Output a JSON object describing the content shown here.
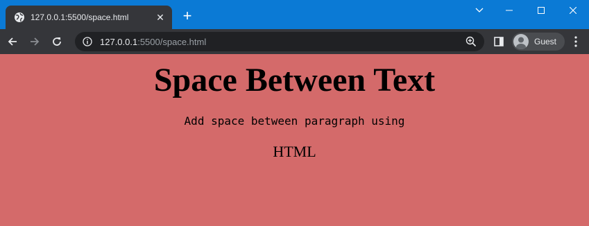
{
  "browser": {
    "tab_title": "127.0.0.1:5500/space.html",
    "tab_close": "✕",
    "new_tab": "+",
    "url_host": "127.0.0.1",
    "url_path": ":5500/space.html",
    "profile_name": "Guest",
    "titlebar_color": "#0b7ad5",
    "toolbar_color": "#35363a"
  },
  "page": {
    "background": "#d46a6a",
    "heading": "Space Between Text",
    "line1": "Add space between paragraph using",
    "line2": "HTML"
  }
}
